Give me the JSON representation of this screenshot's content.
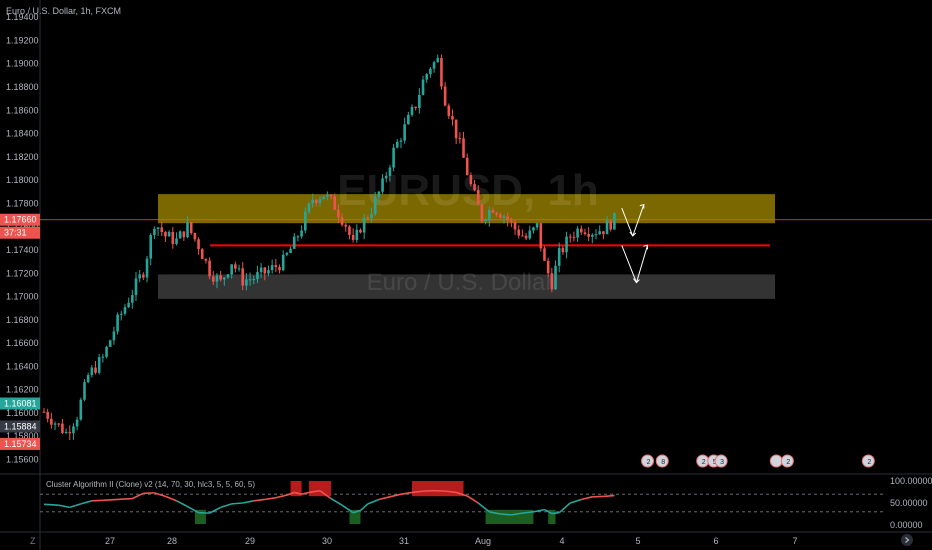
{
  "chart_data": {
    "type": "candlestick",
    "title": "Euro / U.S. Dollar, 1h, FXCM",
    "watermark": {
      "symbol": "EURUSD, 1h",
      "description": "Euro / U.S. Dollar"
    },
    "y_axis": {
      "ticks": [
        "1.19400",
        "1.19200",
        "1.19000",
        "1.18800",
        "1.18600",
        "1.18400",
        "1.18200",
        "1.18000",
        "1.17800",
        "1.17600",
        "1.17400",
        "1.17200",
        "1.17000",
        "1.16800",
        "1.16600",
        "1.16400",
        "1.16200",
        "1.16000",
        "1.15800",
        "1.15600"
      ],
      "range": [
        1.155,
        1.1955
      ]
    },
    "x_axis": {
      "ticks": [
        "27",
        "28",
        "29",
        "30",
        "31",
        "Aug",
        "4",
        "5",
        "6",
        "7"
      ]
    },
    "price_tags": [
      {
        "label": "1.17660",
        "color": "#ef5350"
      },
      {
        "label": "37:31",
        "color": "#ef5350"
      },
      {
        "label": "1.16081",
        "color": "#26a69a"
      },
      {
        "label": "1.15884",
        "color": "#363a45"
      },
      {
        "label": "1.15734",
        "color": "#ef5350"
      }
    ],
    "colors": {
      "up": "#26a69a",
      "down": "#ef5350"
    },
    "zones": [
      {
        "name": "supply",
        "from": 1.1763,
        "to": 1.1788,
        "color": "#c8a800"
      },
      {
        "name": "demand",
        "from": 1.1698,
        "to": 1.1719,
        "color": "#9e9e9e"
      }
    ],
    "lines": [
      {
        "name": "current-price",
        "value": 1.1766,
        "color": "#ef5350"
      },
      {
        "name": "level",
        "value": 1.1744,
        "color": "#ff0000"
      }
    ],
    "path_waypoints": [
      [
        0,
        1.1601
      ],
      [
        3,
        1.1592
      ],
      [
        6,
        1.1583
      ],
      [
        9,
        1.1598
      ],
      [
        12,
        1.1632
      ],
      [
        16,
        1.1647
      ],
      [
        20,
        1.1679
      ],
      [
        24,
        1.1704
      ],
      [
        27,
        1.1722
      ],
      [
        30,
        1.1764
      ],
      [
        33,
        1.1752
      ],
      [
        36,
        1.1748
      ],
      [
        39,
        1.176
      ],
      [
        42,
        1.1744
      ],
      [
        45,
        1.1722
      ],
      [
        48,
        1.1712
      ],
      [
        51,
        1.173
      ],
      [
        54,
        1.1714
      ],
      [
        57,
        1.1716
      ],
      [
        61,
        1.1722
      ],
      [
        65,
        1.173
      ],
      [
        68,
        1.1746
      ],
      [
        70,
        1.176
      ],
      [
        73,
        1.1784
      ],
      [
        76,
        1.1788
      ],
      [
        79,
        1.1778
      ],
      [
        82,
        1.1762
      ],
      [
        84,
        1.1744
      ],
      [
        86,
        1.176
      ],
      [
        89,
        1.1775
      ],
      [
        92,
        1.1796
      ],
      [
        95,
        1.1825
      ],
      [
        98,
        1.1845
      ],
      [
        101,
        1.1865
      ],
      [
        103,
        1.1885
      ],
      [
        105,
        1.1898
      ],
      [
        107,
        1.1903
      ],
      [
        109,
        1.187
      ],
      [
        111,
        1.185
      ],
      [
        113,
        1.183
      ],
      [
        116,
        1.1795
      ],
      [
        119,
        1.1768
      ],
      [
        122,
        1.1777
      ],
      [
        125,
        1.177
      ],
      [
        128,
        1.1758
      ],
      [
        131,
        1.175
      ],
      [
        134,
        1.176
      ],
      [
        136,
        1.1728
      ],
      [
        138,
        1.1712
      ],
      [
        140,
        1.1736
      ],
      [
        143,
        1.1752
      ],
      [
        146,
        1.176
      ],
      [
        149,
        1.1756
      ],
      [
        152,
        1.1758
      ],
      [
        155,
        1.1766
      ]
    ],
    "projection_arrows": [
      {
        "from": [
          157,
          1.1776
        ],
        "via": [
          160,
          1.1752
        ],
        "to": [
          163,
          1.1779
        ]
      },
      {
        "from": [
          157,
          1.1744
        ],
        "via": [
          161,
          1.1712
        ],
        "to": [
          164,
          1.1744
        ]
      }
    ],
    "indicator": {
      "title": "Cluster Algorithm II (Clone) v2 (14, 70, 30, hlc3, 5, 5, 60, 5)",
      "y_ticks": [
        "100.00000",
        "50.00000",
        "0.00000"
      ],
      "range": [
        0,
        100
      ],
      "levels": [
        70,
        30
      ],
      "waypoints": [
        [
          0,
          47
        ],
        [
          4,
          45
        ],
        [
          7,
          40
        ],
        [
          10,
          48
        ],
        [
          13,
          55
        ],
        [
          16,
          56
        ],
        [
          20,
          58
        ],
        [
          24,
          60
        ],
        [
          27,
          72
        ],
        [
          30,
          73
        ],
        [
          33,
          65
        ],
        [
          36,
          55
        ],
        [
          39,
          42
        ],
        [
          42,
          28
        ],
        [
          45,
          27
        ],
        [
          48,
          40
        ],
        [
          51,
          48
        ],
        [
          54,
          50
        ],
        [
          57,
          55
        ],
        [
          60,
          58
        ],
        [
          63,
          62
        ],
        [
          66,
          68
        ],
        [
          68,
          74
        ],
        [
          70,
          70
        ],
        [
          72,
          74
        ],
        [
          75,
          78
        ],
        [
          78,
          60
        ],
        [
          81,
          45
        ],
        [
          84,
          28
        ],
        [
          86,
          33
        ],
        [
          88,
          48
        ],
        [
          91,
          58
        ],
        [
          94,
          64
        ],
        [
          97,
          70
        ],
        [
          100,
          74
        ],
        [
          103,
          77
        ],
        [
          106,
          78
        ],
        [
          109,
          77
        ],
        [
          112,
          74
        ],
        [
          115,
          66
        ],
        [
          118,
          50
        ],
        [
          121,
          30
        ],
        [
          124,
          25
        ],
        [
          127,
          23
        ],
        [
          130,
          27
        ],
        [
          133,
          30
        ],
        [
          136,
          35
        ],
        [
          138,
          26
        ],
        [
          140,
          28
        ],
        [
          143,
          50
        ],
        [
          146,
          58
        ],
        [
          149,
          64
        ],
        [
          152,
          65
        ],
        [
          155,
          67
        ]
      ],
      "bands": [
        {
          "from": 67,
          "to": 70,
          "zone": "high"
        },
        {
          "from": 72,
          "to": 78,
          "zone": "high"
        },
        {
          "from": 100,
          "to": 114,
          "zone": "high"
        },
        {
          "from": 41,
          "to": 44,
          "zone": "low"
        },
        {
          "from": 83,
          "to": 86,
          "zone": "low"
        },
        {
          "from": 120,
          "to": 133,
          "zone": "low"
        },
        {
          "from": 137,
          "to": 139,
          "zone": "low"
        }
      ],
      "colors": {
        "line_high": "#ef5350",
        "line_low": "#26a69a",
        "band_high": "#b71c1c",
        "band_low": "#1b5e20"
      }
    },
    "event_markers": [
      {
        "bar": 164,
        "label": "2"
      },
      {
        "bar": 168,
        "label": "8"
      },
      {
        "bar": 179,
        "label": "2"
      },
      {
        "bar": 182,
        "label": "5"
      },
      {
        "bar": 184,
        "label": "3"
      },
      {
        "bar": 199,
        "label": ""
      },
      {
        "bar": 202,
        "label": "2"
      },
      {
        "bar": 224,
        "label": "2"
      }
    ]
  },
  "footer": {
    "logo": "Z",
    "nav_icon": "chevron-right"
  }
}
